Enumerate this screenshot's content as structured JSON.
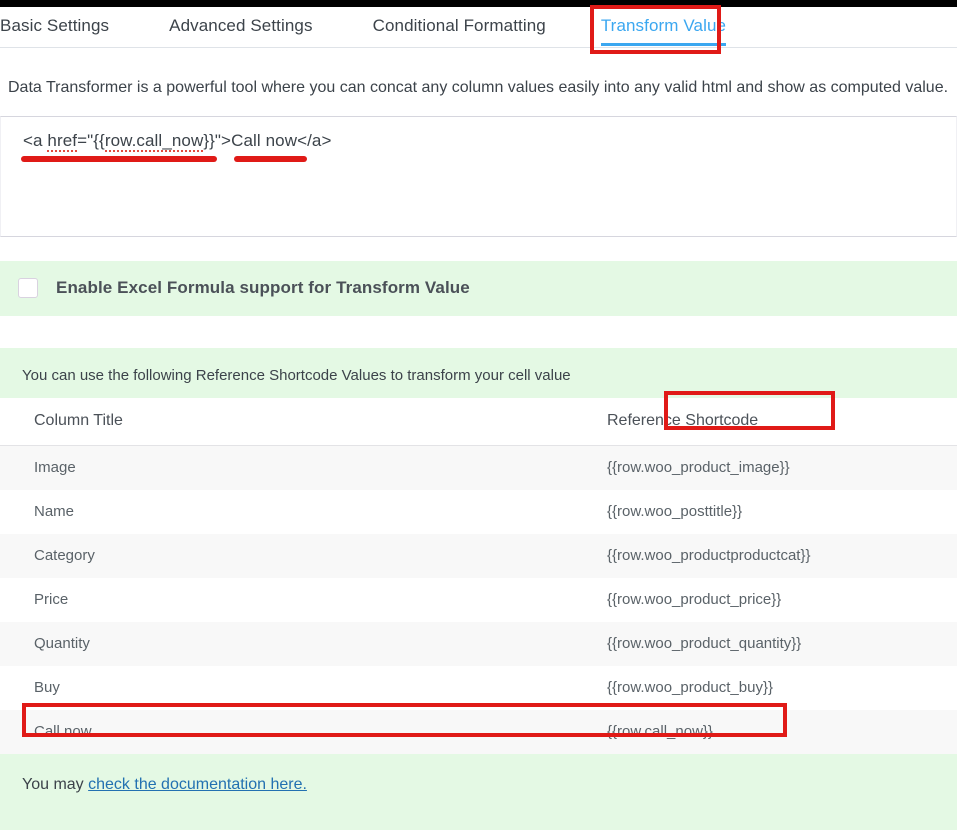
{
  "tabs": [
    {
      "label": "Basic Settings",
      "active": false
    },
    {
      "label": "Advanced Settings",
      "active": false
    },
    {
      "label": "Conditional Formatting",
      "active": false
    },
    {
      "label": "Transform Value",
      "active": true
    }
  ],
  "description": "Data Transformer is a powerful tool where you can concat any column values easily into any valid html and show as computed value.",
  "editor": {
    "code_prefix": "<a ",
    "code_href_word": "href",
    "code_mid": "=\"{{",
    "code_token": "row.call_now",
    "code_close": "}}\">",
    "code_tail": "Call now</a>",
    "full_value": "<a href=\"{{row.call_now}}\">Call now</a>"
  },
  "excel_toggle": {
    "label": "Enable Excel Formula support for Transform Value",
    "checked": false
  },
  "reference": {
    "note": "You can use the following Reference Shortcode Values to transform your cell value",
    "columns": [
      "Column Title",
      "Reference Shortcode"
    ],
    "rows": [
      {
        "title": "Image",
        "shortcode": "{{row.woo_product_image}}"
      },
      {
        "title": "Name",
        "shortcode": "{{row.woo_posttitle}}"
      },
      {
        "title": "Category",
        "shortcode": "{{row.woo_productproductcat}}"
      },
      {
        "title": "Price",
        "shortcode": "{{row.woo_product_price}}"
      },
      {
        "title": "Quantity",
        "shortcode": "{{row.woo_product_quantity}}"
      },
      {
        "title": "Buy",
        "shortcode": "{{row.woo_product_buy}}"
      },
      {
        "title": "Call now",
        "shortcode": "{{row.call_now}}"
      }
    ]
  },
  "footer": {
    "prefix": "You may ",
    "link_text": "check the documentation here."
  },
  "colors": {
    "annotation": "#e01a17",
    "active_tab": "#3ba7f0",
    "panel_green": "#e4f9e4",
    "link": "#2271b1"
  }
}
